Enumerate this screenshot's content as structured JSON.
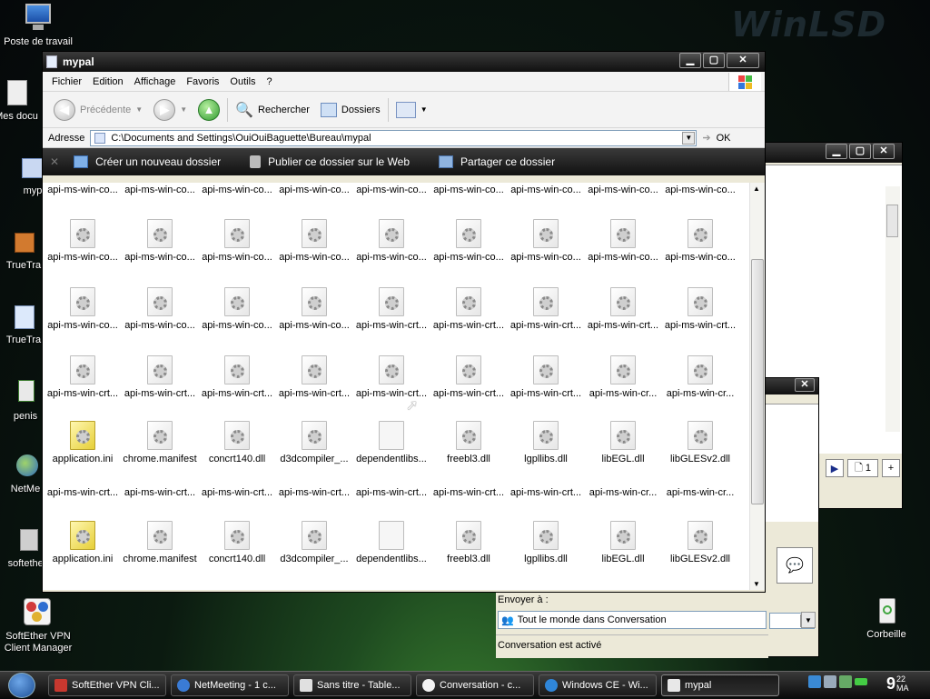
{
  "desktop": {
    "watermark": "WinLSD",
    "icons": [
      {
        "label": "Poste de travail"
      },
      {
        "label": "Mes docu"
      },
      {
        "label": "myp"
      },
      {
        "label": "TrueTra"
      },
      {
        "label": "TrueTra"
      },
      {
        "label": "penis"
      },
      {
        "label": "NetMe"
      },
      {
        "label": "softether"
      },
      {
        "label": "SoftEther VPN Client Manager"
      },
      {
        "label": "Corbeille"
      }
    ]
  },
  "explorer": {
    "title": "mypal",
    "menu": [
      "Fichier",
      "Edition",
      "Affichage",
      "Favoris",
      "Outils",
      "?"
    ],
    "toolbar": {
      "back": "Précédente",
      "search": "Rechercher",
      "folders": "Dossiers"
    },
    "address": {
      "label": "Adresse",
      "path": "C:\\Documents and Settings\\OuiOuiBaguette\\Bureau\\mypal",
      "go": "OK"
    },
    "tasks": [
      "Créer un nouveau dossier",
      "Publier ce dossier sur le Web",
      "Partager ce dossier"
    ],
    "rows": [
      [
        {
          "n": "api-ms-win-co...",
          "t": "label-only"
        },
        {
          "n": "api-ms-win-co...",
          "t": "label-only"
        },
        {
          "n": "api-ms-win-co...",
          "t": "label-only"
        },
        {
          "n": "api-ms-win-co...",
          "t": "label-only"
        },
        {
          "n": "api-ms-win-co...",
          "t": "label-only"
        },
        {
          "n": "api-ms-win-co...",
          "t": "label-only"
        },
        {
          "n": "api-ms-win-co...",
          "t": "label-only"
        },
        {
          "n": "api-ms-win-co...",
          "t": "label-only"
        },
        {
          "n": "api-ms-win-co...",
          "t": "label-only"
        }
      ],
      [
        {
          "n": "api-ms-win-co...",
          "t": "dll"
        },
        {
          "n": "api-ms-win-co...",
          "t": "dll"
        },
        {
          "n": "api-ms-win-co...",
          "t": "dll"
        },
        {
          "n": "api-ms-win-co...",
          "t": "dll"
        },
        {
          "n": "api-ms-win-co...",
          "t": "dll"
        },
        {
          "n": "api-ms-win-co...",
          "t": "dll"
        },
        {
          "n": "api-ms-win-co...",
          "t": "dll"
        },
        {
          "n": "api-ms-win-co...",
          "t": "dll"
        },
        {
          "n": "api-ms-win-co...",
          "t": "dll"
        }
      ],
      [
        {
          "n": "api-ms-win-co...",
          "t": "dll"
        },
        {
          "n": "api-ms-win-co...",
          "t": "dll"
        },
        {
          "n": "api-ms-win-co...",
          "t": "dll"
        },
        {
          "n": "api-ms-win-co...",
          "t": "dll"
        },
        {
          "n": "api-ms-win-crt...",
          "t": "dll"
        },
        {
          "n": "api-ms-win-crt...",
          "t": "dll"
        },
        {
          "n": "api-ms-win-crt...",
          "t": "dll"
        },
        {
          "n": "api-ms-win-crt...",
          "t": "dll"
        },
        {
          "n": "api-ms-win-crt...",
          "t": "dll"
        }
      ],
      [
        {
          "n": "api-ms-win-crt...",
          "t": "dll"
        },
        {
          "n": "api-ms-win-crt...",
          "t": "dll"
        },
        {
          "n": "api-ms-win-crt...",
          "t": "dll"
        },
        {
          "n": "api-ms-win-crt...",
          "t": "dll"
        },
        {
          "n": "api-ms-win-crt...",
          "t": "dll"
        },
        {
          "n": "api-ms-win-crt...",
          "t": "dll"
        },
        {
          "n": "api-ms-win-crt...",
          "t": "dll"
        },
        {
          "n": "api-ms-win-cr...",
          "t": "dll"
        },
        {
          "n": "api-ms-win-cr...",
          "t": "dll"
        }
      ],
      [
        {
          "n": "application.ini",
          "t": "ini"
        },
        {
          "n": "chrome.manifest",
          "t": "dll"
        },
        {
          "n": "concrt140.dll",
          "t": "dll"
        },
        {
          "n": "d3dcompiler_...",
          "t": "dll"
        },
        {
          "n": "dependentlibs...",
          "t": "blank"
        },
        {
          "n": "freebl3.dll",
          "t": "dll"
        },
        {
          "n": "lgpllibs.dll",
          "t": "dll"
        },
        {
          "n": "libEGL.dll",
          "t": "dll"
        },
        {
          "n": "libGLESv2.dll",
          "t": "dll"
        }
      ],
      [
        {
          "n": "api-ms-win-crt...",
          "t": "label-only"
        },
        {
          "n": "api-ms-win-crt...",
          "t": "label-only"
        },
        {
          "n": "api-ms-win-crt...",
          "t": "label-only"
        },
        {
          "n": "api-ms-win-crt...",
          "t": "label-only"
        },
        {
          "n": "api-ms-win-crt...",
          "t": "label-only"
        },
        {
          "n": "api-ms-win-crt...",
          "t": "label-only"
        },
        {
          "n": "api-ms-win-crt...",
          "t": "label-only"
        },
        {
          "n": "api-ms-win-cr...",
          "t": "label-only"
        },
        {
          "n": "api-ms-win-cr...",
          "t": "label-only"
        }
      ],
      [
        {
          "n": "application.ini",
          "t": "ini"
        },
        {
          "n": "chrome.manifest",
          "t": "dll"
        },
        {
          "n": "concrt140.dll",
          "t": "dll"
        },
        {
          "n": "d3dcompiler_...",
          "t": "dll"
        },
        {
          "n": "dependentlibs...",
          "t": "blank"
        },
        {
          "n": "freebl3.dll",
          "t": "dll"
        },
        {
          "n": "lgpllibs.dll",
          "t": "dll"
        },
        {
          "n": "libEGL.dll",
          "t": "dll"
        },
        {
          "n": "libGLESv2.dll",
          "t": "dll"
        }
      ]
    ]
  },
  "chat": {
    "send_to_label": "Envoyer à :",
    "recipient": "Tout le monde dans Conversation",
    "status": "Conversation est activé"
  },
  "doc_window": {
    "page_value": "1"
  },
  "taskbar": {
    "items": [
      {
        "label": "SoftEther VPN Cli...",
        "color": "#c8382f"
      },
      {
        "label": "NetMeeting - 1 c...",
        "color": "#3a7bd5"
      },
      {
        "label": "Sans titre - Table...",
        "color": "#e0e0e0"
      },
      {
        "label": "Conversation - c...",
        "color": "#f2f2f2"
      },
      {
        "label": "Windows CE - Wi...",
        "color": "#2f86d9"
      },
      {
        "label": "mypal",
        "color": "#e8e8e8"
      }
    ],
    "clock_time": "9",
    "clock_min": "22",
    "clock_ampm": "MA"
  }
}
